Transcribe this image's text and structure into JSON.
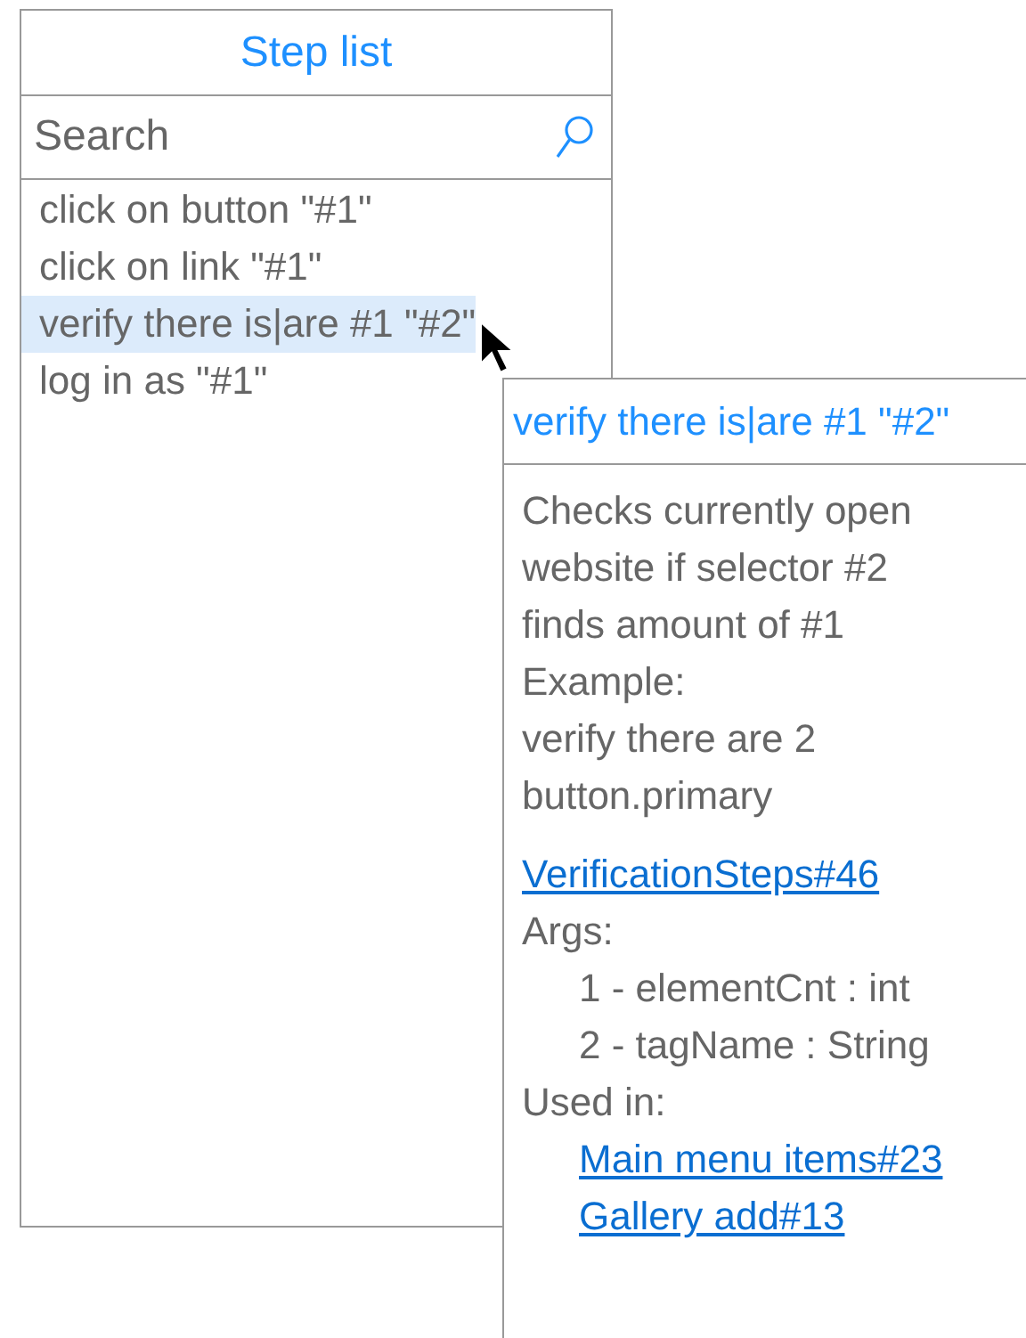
{
  "step_list": {
    "title": "Step list",
    "search": {
      "placeholder": "Search"
    },
    "items": [
      {
        "label": "click on button \"#1\"",
        "selected": false
      },
      {
        "label": "click on link \"#1\"",
        "selected": false
      },
      {
        "label": "verify there is|are #1 \"#2\"",
        "selected": true
      },
      {
        "label": "log in as \"#1\"",
        "selected": false
      }
    ]
  },
  "tooltip": {
    "title": "verify there is|are #1 \"#2\"",
    "description_lines": [
      "Checks currently open",
      "website if selector #2",
      "finds amount of #1",
      "Example:",
      "verify there are 2",
      "button.primary"
    ],
    "source_link": "VerificationSteps#46",
    "args_label": "Args:",
    "args": [
      "1 - elementCnt : int",
      "2 - tagName : String"
    ],
    "used_in_label": "Used in:",
    "used_in": [
      "Main menu items#23",
      "Gallery add#13"
    ]
  }
}
